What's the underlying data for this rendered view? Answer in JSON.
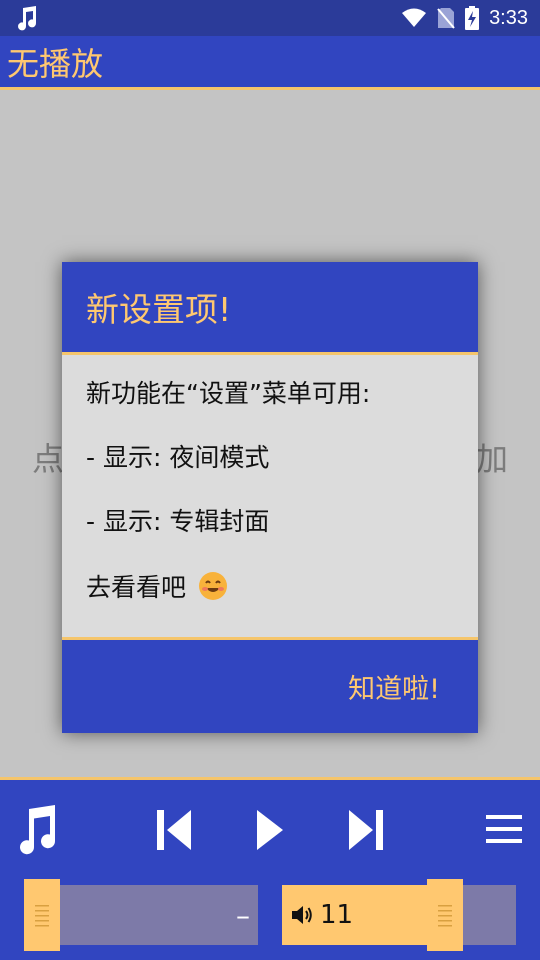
{
  "status_bar": {
    "time": "3:33"
  },
  "app": {
    "title": "无播放"
  },
  "background": {
    "left_fragment": "点",
    "right_fragment": "加"
  },
  "dialog": {
    "title": "新设置项!",
    "lines": [
      "新功能在“设置”菜单可用:",
      "- 显示: 夜间模式",
      "- 显示: 专辑封面",
      "去看看吧"
    ],
    "ok_label": "知道啦!"
  },
  "player": {
    "seek_text": "–",
    "volume_value": "11",
    "volume_level_fraction": 0.7
  },
  "colors": {
    "primary": "#3145c0",
    "accent": "#ffc870",
    "divider": "#f5c56b"
  }
}
